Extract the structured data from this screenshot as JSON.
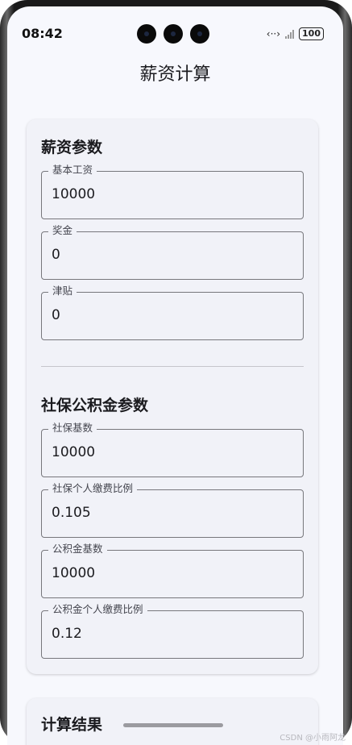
{
  "status_bar": {
    "time": "08:42",
    "battery": "100"
  },
  "app_bar": {
    "title": "薪资计算"
  },
  "salary_section": {
    "title": "薪资参数",
    "fields": [
      {
        "label": "基本工资",
        "value": "10000"
      },
      {
        "label": "奖金",
        "value": "0"
      },
      {
        "label": "津贴",
        "value": "0"
      }
    ]
  },
  "insurance_section": {
    "title": "社保公积金参数",
    "fields": [
      {
        "label": "社保基数",
        "value": "10000"
      },
      {
        "label": "社保个人缴费比例",
        "value": "0.105"
      },
      {
        "label": "公积金基数",
        "value": "10000"
      },
      {
        "label": "公积金个人缴费比例",
        "value": "0.12"
      }
    ]
  },
  "result_section": {
    "title": "计算结果"
  },
  "watermark": "CSDN @小雨阿龙",
  "colors": {
    "background": "#f7f8fd",
    "card": "#f1f2f8",
    "outline": "#77777c",
    "text": "#1b1b1f"
  },
  "icons": [
    "nfc-icon",
    "no-signal-icon",
    "battery-icon"
  ]
}
